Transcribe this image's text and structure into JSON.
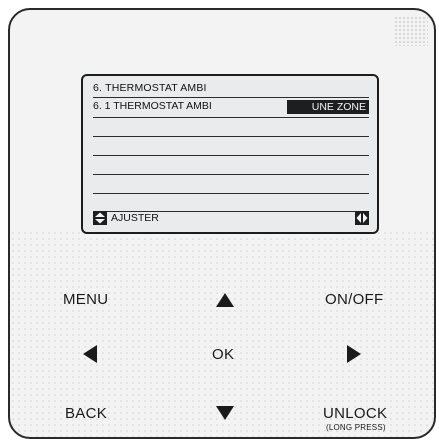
{
  "screen": {
    "title": "6.  THERMOSTAT AMBI",
    "row1_label": "6. 1 THERMOSTAT AMBI",
    "row1_value": "UNE ZONE",
    "footer_label": "AJUSTER",
    "footer_left_icon": "up-down-arrows-icon",
    "footer_right_icon": "left-right-arrows-icon"
  },
  "buttons": {
    "menu": "MENU",
    "on_off": "ON/OFF",
    "ok": "OK",
    "back": "BACK",
    "unlock": "UNLOCK",
    "unlock_sub": "(LONG PRESS)"
  },
  "colors": {
    "panel": "#f3f3f3",
    "lcd": "#e9ebed",
    "ink": "#1a1a1a"
  }
}
